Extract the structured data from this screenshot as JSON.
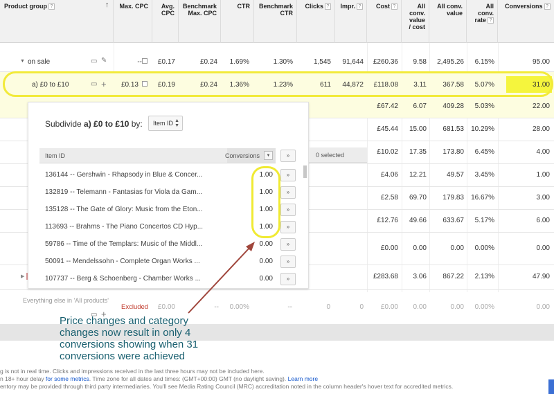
{
  "header": {
    "product_group": "Product group",
    "max_cpc": "Max. CPC",
    "avg_cpc_1": "Avg.",
    "avg_cpc_2": "CPC",
    "bench_max_cpc_1": "Benchmark",
    "bench_max_cpc_2": "Max. CPC",
    "ctr": "CTR",
    "bench_ctr_1": "Benchmark",
    "bench_ctr_2": "CTR",
    "clicks": "Clicks",
    "impr": "Impr.",
    "cost": "Cost",
    "acv_cost_1": "All",
    "acv_cost_2": "conv.",
    "acv_cost_3": "value",
    "acv_cost_4": "/ cost",
    "all_conv_value_1": "All conv.",
    "all_conv_value_2": "value",
    "all_conv_rate_1": "All",
    "all_conv_rate_2": "conv.",
    "all_conv_rate_3": "rate",
    "conversions": "Conversions",
    "help_glyph": "?",
    "sort_glyph": "↑"
  },
  "rows": {
    "on_sale": {
      "label": "on sale",
      "max_cpc": "--",
      "avg_cpc": "£0.17",
      "bench_max_cpc": "£0.24",
      "ctr": "1.69%",
      "bench_ctr": "1.30%",
      "clicks": "1,545",
      "impr": "91,644",
      "cost": "£260.36",
      "acv_cost": "9.58",
      "acv": "2,495.26",
      "rate": "6.15%",
      "conversions": "95.00"
    },
    "a_0_10": {
      "label": "a) £0 to £10",
      "max_cpc": "£0.13",
      "avg_cpc": "£0.19",
      "bench_max_cpc": "£0.24",
      "ctr": "1.36%",
      "bench_ctr": "1.23%",
      "clicks": "611",
      "impr": "44,872",
      "cost": "£118.08",
      "acv_cost": "3.11",
      "acv": "367.58",
      "rate": "5.07%",
      "conversions": "31.00"
    },
    "right_rows": [
      {
        "cost": "£67.42",
        "acv_cost": "6.07",
        "acv": "409.28",
        "rate": "5.03%",
        "conversions": "22.00"
      },
      {
        "cost": "£45.44",
        "acv_cost": "15.00",
        "acv": "681.53",
        "rate": "10.29%",
        "conversions": "28.00"
      },
      {
        "cost": "£10.02",
        "acv_cost": "17.35",
        "acv": "173.80",
        "rate": "6.45%",
        "conversions": "4.00"
      },
      {
        "cost": "£4.06",
        "acv_cost": "12.21",
        "acv": "49.57",
        "rate": "3.45%",
        "conversions": "1.00"
      },
      {
        "cost": "£2.58",
        "acv_cost": "69.70",
        "acv": "179.83",
        "rate": "16.67%",
        "conversions": "3.00"
      },
      {
        "cost": "£12.76",
        "acv_cost": "49.66",
        "acv": "633.67",
        "rate": "5.17%",
        "conversions": "6.00"
      },
      {
        "cost": "£0.00",
        "acv_cost": "0.00",
        "acv": "0.00",
        "rate": "0.00%",
        "conversions": "0.00"
      },
      {
        "cost": "£283.68",
        "acv_cost": "3.06",
        "acv": "867.22",
        "rate": "2.13%",
        "conversions": "47.90"
      }
    ],
    "everything_else": {
      "label": "Everything else in 'All products'",
      "status": "Excluded",
      "avg_cpc": "£0.00",
      "bench_max_cpc": "--",
      "ctr": "0.00%",
      "bench_ctr": "--",
      "clicks": "0",
      "impr": "0",
      "cost": "£0.00",
      "acv_cost": "0.00",
      "acv": "0.00",
      "rate": "0.00%",
      "conversions": "0.00"
    }
  },
  "subdivide": {
    "title_prefix": "Subdivide ",
    "title_bold": "a) £0 to £10",
    "title_suffix": " by:",
    "select_value": "Item ID",
    "col_item_id": "Item ID",
    "col_conversions": "Conversions",
    "add_all": "»",
    "selected": "0 selected",
    "items": [
      {
        "label": "136144 -- Gershwin - Rhapsody in Blue & Concer...",
        "conv": "1.00"
      },
      {
        "label": "132819 -- Telemann - Fantasias for Viola da Gam...",
        "conv": "1.00"
      },
      {
        "label": "135128 -- The Gate of Glory: Music from the Eton...",
        "conv": "1.00"
      },
      {
        "label": "113693 -- Brahms - The Piano Concertos CD Hyp...",
        "conv": "1.00"
      },
      {
        "label": "59786 -- Time of the Templars: Music of the Middl...",
        "conv": "0.00"
      },
      {
        "label": "50091 -- Mendelssohn - Complete Organ Works ...",
        "conv": "0.00"
      },
      {
        "label": "107737 -- Berg & Schoenberg - Chamber Works ...",
        "conv": "0.00"
      }
    ],
    "item_add": "»"
  },
  "annotation": "Price changes and category changes now result in only 4 conversions showing when 31 conversions were achieved",
  "footer": {
    "line1": "g is not in real time. Clicks and impressions received in the last three hours may not be included here.",
    "line2_a": "n 18+ hour delay ",
    "line2_link1": "for some metrics",
    "line2_b": ". Time zone for all dates and times: (GMT+00:00) GMT (no daylight saving). ",
    "line2_link2": "Learn more",
    "line3": "entory may be provided through third party intermediaries. You'll see Media Rating Council (MRC) accreditation noted in the column header's hover text for accredited metrics."
  },
  "colors": {
    "highlight": "#f5f53d",
    "ring": "#f2ea3a",
    "annotation": "#1a6070",
    "arrow": "#a0463c"
  }
}
